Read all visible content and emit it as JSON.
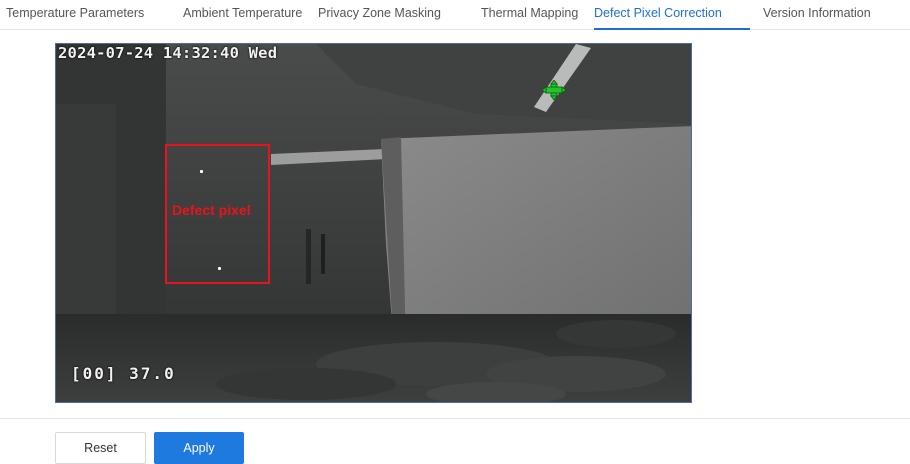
{
  "tabs": [
    {
      "label": "Temperature Parameters",
      "active": false
    },
    {
      "label": "Ambient Temperature",
      "active": false
    },
    {
      "label": "Privacy Zone Masking",
      "active": false
    },
    {
      "label": "Thermal Mapping",
      "active": false
    },
    {
      "label": "Defect Pixel Correction",
      "active": true
    },
    {
      "label": "Version Information",
      "active": false
    }
  ],
  "video": {
    "timestamp": "2024-07-24 14:32:40 Wed",
    "temperature_readout": "[00] 37.0",
    "defect_label": "Defect pixel",
    "cursor_icon": "green-crosshair-icon"
  },
  "buttons": {
    "reset": "Reset",
    "apply": "Apply"
  },
  "colors": {
    "accent": "#1f7ae0",
    "active_tab": "#1f6fd1",
    "defect_marker": "#e8141b",
    "cursor": "#22c52a"
  }
}
